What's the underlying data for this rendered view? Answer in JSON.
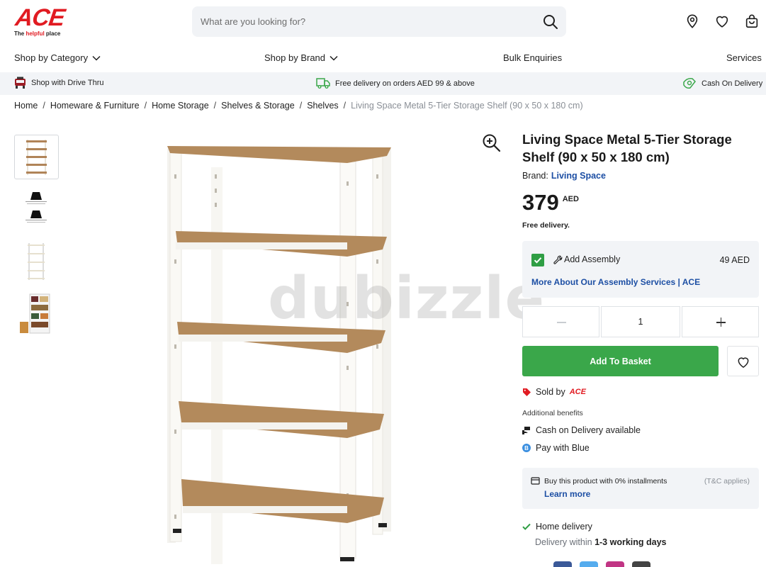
{
  "header": {
    "logo_text": "ACE",
    "logo_tagline_prefix": "The ",
    "logo_tagline_highlight": "helpful",
    "logo_tagline_suffix": " place",
    "search_placeholder": "What are you looking for?"
  },
  "nav": {
    "items": [
      "Shop by Category",
      "Shop by Brand",
      "Bulk Enquiries",
      "Services"
    ]
  },
  "strip": {
    "drive_thru": "Shop with Drive Thru",
    "free_delivery": "Free delivery on orders AED 99 & above",
    "cod": "Cash On Delivery"
  },
  "breadcrumb": {
    "items": [
      "Home",
      "Homeware & Furniture",
      "Home Storage",
      "Shelves & Storage",
      "Shelves"
    ],
    "current": "Living Space Metal 5-Tier Storage Shelf (90 x 50 x 180 cm)",
    "separator": "/"
  },
  "gallery": {
    "watermark": "dubizzle"
  },
  "product": {
    "title": "Living Space Metal 5-Tier Storage Shelf (90 x 50 x 180 cm)",
    "brand_label": "Brand:",
    "brand_name": "Living Space",
    "price": "379",
    "currency": "AED",
    "free_delivery": "Free delivery."
  },
  "assembly": {
    "label": "Add Assembly",
    "price": "49 AED",
    "link": "More About Our Assembly Services | ACE"
  },
  "quantity": {
    "value": "1"
  },
  "actions": {
    "add_to_basket": "Add To Basket"
  },
  "seller": {
    "sold_by": "Sold by",
    "seller_name": "ACE"
  },
  "benefits": {
    "heading": "Additional benefits",
    "items": [
      "Cash on Delivery available",
      "Pay with Blue"
    ]
  },
  "installments": {
    "text": "Buy this product with 0% installments",
    "tc": "(T&C applies)",
    "link": "Learn more"
  },
  "delivery": {
    "title": "Home delivery",
    "sub_prefix": "Delivery within ",
    "sub_bold": "1-3 working days"
  },
  "colors": {
    "brand_red": "#e11b22",
    "link_blue": "#1d4fa4",
    "green": "#3aa74a"
  }
}
